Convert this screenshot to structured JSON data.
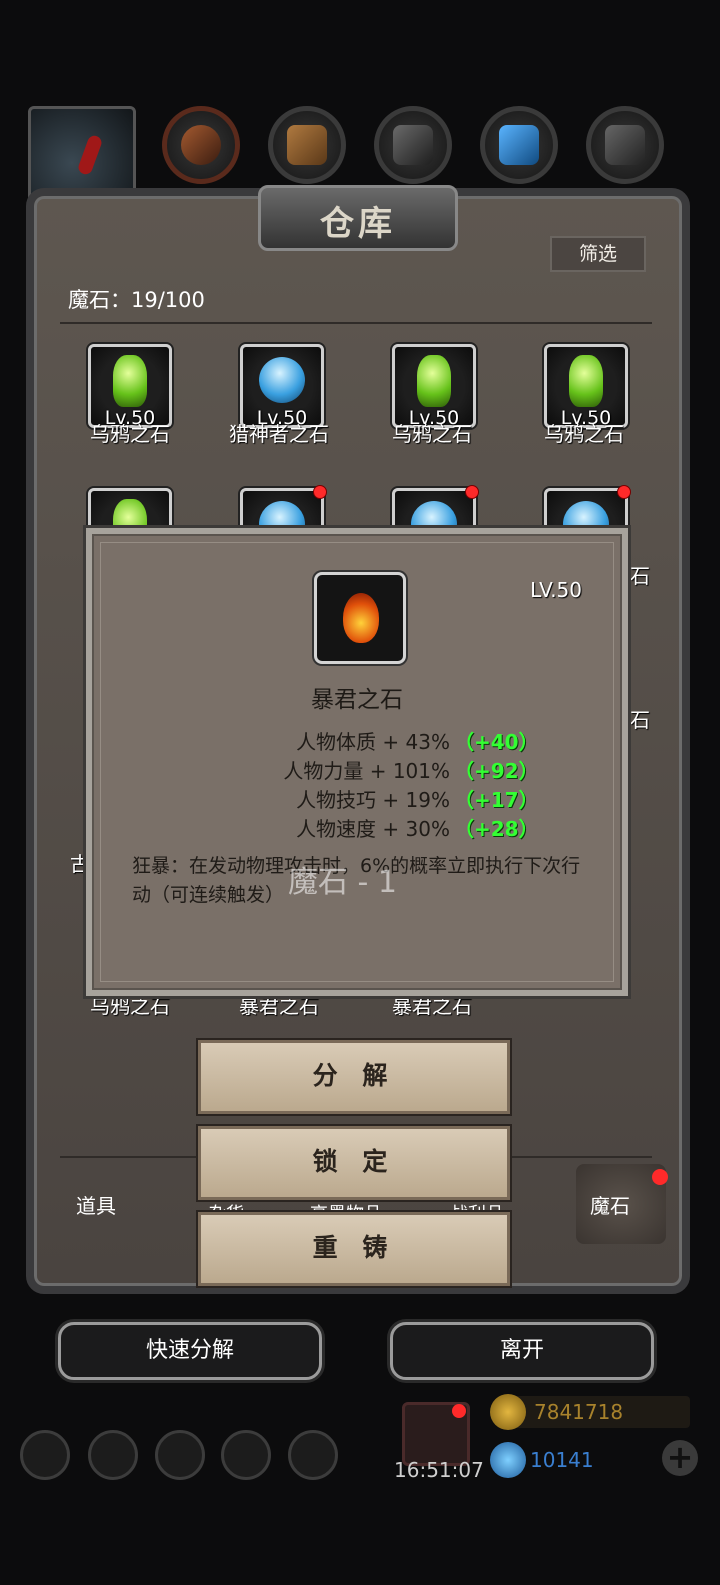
{
  "panel": {
    "title": "仓库",
    "filter_label": "筛选",
    "count_label": "魔石：19/100"
  },
  "grid": {
    "row1": [
      {
        "name": "乌鸦之石",
        "level": "Lv.50",
        "gem": "green"
      },
      {
        "name": "猎神者之石",
        "level": "Lv.50",
        "gem": "blue"
      },
      {
        "name": "乌鸦之石",
        "level": "Lv.50",
        "gem": "green"
      },
      {
        "name": "乌鸦之石",
        "level": "Lv.50",
        "gem": "green"
      }
    ],
    "hidden_names_visible": [
      "古",
      "石",
      "石"
    ],
    "row_bottom": [
      "乌鸦之石",
      "暴君之石",
      "暴君之石"
    ]
  },
  "bottom_tabs": {
    "items": "道具",
    "partial1": "杂货",
    "partial2": "高墨物品",
    "partial3": "战利品",
    "magic_stone": "魔石"
  },
  "popup": {
    "level": "LV.50",
    "name": "暴君之石",
    "stats": [
      {
        "label": "人物体质 + 43%",
        "bonus": "（+40）"
      },
      {
        "label": "人物力量 + 101%",
        "bonus": "（+92）"
      },
      {
        "label": "人物技巧 + 19%",
        "bonus": "（+17）"
      },
      {
        "label": "人物速度 + 30%",
        "bonus": "（+28）"
      }
    ],
    "description": "狂暴：在发动物理攻击时，6%的概率立即执行下次行动（可连续触发）",
    "toast": "魔石 - 1"
  },
  "actions": {
    "decompose": "分 解",
    "lock": "锁 定",
    "recast": "重 铸"
  },
  "footer": {
    "quick_decompose": "快速分解",
    "leave": "离开"
  },
  "hud": {
    "time": "16:51:07",
    "gold": "7841718",
    "gems": "10141",
    "plus": "+"
  },
  "colors": {
    "bonus_green": "#33ff33",
    "badge_red": "#ff2a2a"
  }
}
